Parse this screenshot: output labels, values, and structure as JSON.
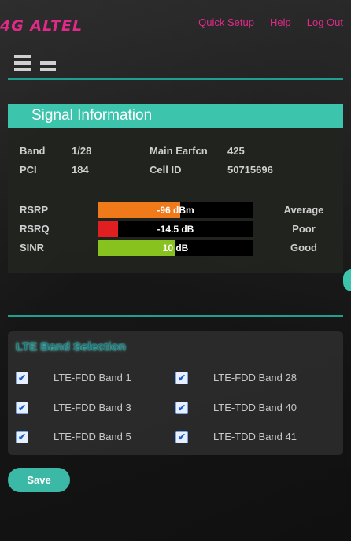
{
  "header": {
    "logo": "4G ALTEL",
    "nav": [
      "Quick Setup",
      "Help",
      "Log Out"
    ]
  },
  "signal": {
    "title": "Signal Information",
    "info": {
      "band_label": "Band",
      "band_value": "1/28",
      "earfcn_label": "Main Earfcn",
      "earfcn_value": "425",
      "pci_label": "PCI",
      "pci_value": "184",
      "cellid_label": "Cell ID",
      "cellid_value": "50715696"
    },
    "meters": [
      {
        "label": "RSRP",
        "value": "-96 dBm",
        "quality": "Average",
        "fill": 0.53,
        "color": "#f07a1a"
      },
      {
        "label": "RSRQ",
        "value": "-14.5 dB",
        "quality": "Poor",
        "fill": 0.13,
        "color": "#e02020"
      },
      {
        "label": "SINR",
        "value": "10 dB",
        "quality": "Good",
        "fill": 0.5,
        "color": "#88c21e"
      }
    ]
  },
  "bands": {
    "title": "LTE Band Selection",
    "items": [
      {
        "label": "LTE-FDD Band 1",
        "checked": true
      },
      {
        "label": "LTE-FDD Band 28",
        "checked": true
      },
      {
        "label": "LTE-FDD Band 3",
        "checked": true
      },
      {
        "label": "LTE-TDD Band 40",
        "checked": true
      },
      {
        "label": "LTE-FDD Band 5",
        "checked": true
      },
      {
        "label": "LTE-TDD Band 41",
        "checked": true
      }
    ]
  },
  "save_label": "Save",
  "colors": {
    "accent": "#3cc4ac",
    "brand": "#e02a8a"
  }
}
